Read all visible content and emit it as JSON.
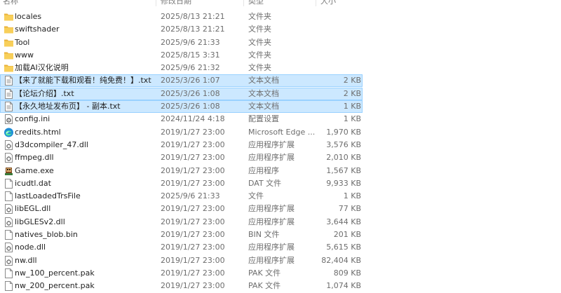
{
  "header": {
    "name": "名称",
    "date": "修改日期",
    "type": "类型",
    "size": "大小"
  },
  "files": [
    {
      "name": "locales",
      "date": "2025/8/13 21:21",
      "type": "文件夹",
      "size": "",
      "icon": "folder-icon",
      "selected": false
    },
    {
      "name": "swiftshader",
      "date": "2025/8/13 21:21",
      "type": "文件夹",
      "size": "",
      "icon": "folder-icon",
      "selected": false
    },
    {
      "name": "Tool",
      "date": "2025/9/6 21:33",
      "type": "文件夹",
      "size": "",
      "icon": "folder-icon",
      "selected": false
    },
    {
      "name": "www",
      "date": "2025/8/15 3:31",
      "type": "文件夹",
      "size": "",
      "icon": "folder-icon",
      "selected": false
    },
    {
      "name": "加载AI汉化说明",
      "date": "2025/9/6 21:32",
      "type": "文件夹",
      "size": "",
      "icon": "folder-icon",
      "selected": false
    },
    {
      "name": "【来了就能下载和观看！纯免费！】.txt",
      "date": "2025/3/26 1:07",
      "type": "文本文档",
      "size": "2 KB",
      "icon": "text-file-icon",
      "selected": true
    },
    {
      "name": "【论坛介绍】.txt",
      "date": "2025/3/26 1:08",
      "type": "文本文档",
      "size": "2 KB",
      "icon": "text-file-icon",
      "selected": true
    },
    {
      "name": "【永久地址发布页】 - 副本.txt",
      "date": "2025/3/26 1:08",
      "type": "文本文档",
      "size": "1 KB",
      "icon": "text-file-icon",
      "selected": true
    },
    {
      "name": "config.ini",
      "date": "2024/11/24 4:18",
      "type": "配置设置",
      "size": "1 KB",
      "icon": "config-file-icon",
      "selected": false
    },
    {
      "name": "credits.html",
      "date": "2019/1/27 23:00",
      "type": "Microsoft Edge ...",
      "size": "1,970 KB",
      "icon": "edge-icon",
      "selected": false
    },
    {
      "name": "d3dcompiler_47.dll",
      "date": "2019/1/27 23:00",
      "type": "应用程序扩展",
      "size": "3,576 KB",
      "icon": "dll-file-icon",
      "selected": false
    },
    {
      "name": "ffmpeg.dll",
      "date": "2019/1/27 23:00",
      "type": "应用程序扩展",
      "size": "2,010 KB",
      "icon": "dll-file-icon",
      "selected": false
    },
    {
      "name": "Game.exe",
      "date": "2019/1/27 23:00",
      "type": "应用程序",
      "size": "1,567 KB",
      "icon": "game-exe-icon",
      "selected": false
    },
    {
      "name": "icudtl.dat",
      "date": "2019/1/27 23:00",
      "type": "DAT 文件",
      "size": "9,933 KB",
      "icon": "blank-file-icon",
      "selected": false
    },
    {
      "name": "lastLoadedTrsFile",
      "date": "2025/9/6 21:33",
      "type": "文件",
      "size": "1 KB",
      "icon": "blank-file-icon",
      "selected": false
    },
    {
      "name": "libEGL.dll",
      "date": "2019/1/27 23:00",
      "type": "应用程序扩展",
      "size": "77 KB",
      "icon": "dll-file-icon",
      "selected": false
    },
    {
      "name": "libGLESv2.dll",
      "date": "2019/1/27 23:00",
      "type": "应用程序扩展",
      "size": "3,644 KB",
      "icon": "dll-file-icon",
      "selected": false
    },
    {
      "name": "natives_blob.bin",
      "date": "2019/1/27 23:00",
      "type": "BIN 文件",
      "size": "201 KB",
      "icon": "blank-file-icon",
      "selected": false
    },
    {
      "name": "node.dll",
      "date": "2019/1/27 23:00",
      "type": "应用程序扩展",
      "size": "5,615 KB",
      "icon": "dll-file-icon",
      "selected": false
    },
    {
      "name": "nw.dll",
      "date": "2019/1/27 23:00",
      "type": "应用程序扩展",
      "size": "82,404 KB",
      "icon": "dll-file-icon",
      "selected": false
    },
    {
      "name": "nw_100_percent.pak",
      "date": "2019/1/27 23:00",
      "type": "PAK 文件",
      "size": "809 KB",
      "icon": "blank-file-icon",
      "selected": false
    },
    {
      "name": "nw_200_percent.pak",
      "date": "2019/1/27 23:00",
      "type": "PAK 文件",
      "size": "1,074 KB",
      "icon": "blank-file-icon",
      "selected": false
    }
  ]
}
